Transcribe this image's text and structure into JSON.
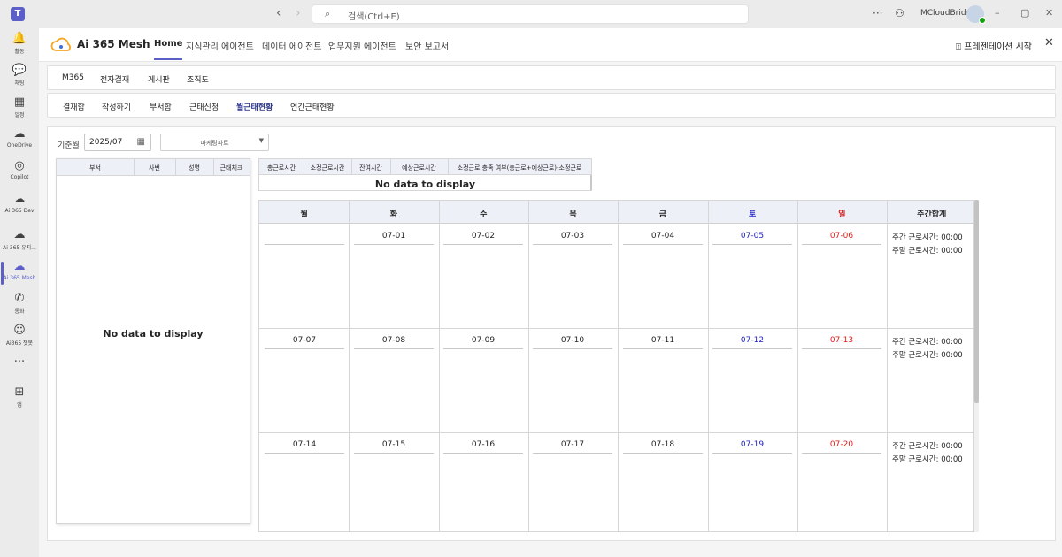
{
  "titlebar": {
    "search_placeholder": "검색(Ctrl+E)",
    "user_name": "MCloudBridge",
    "more": "···"
  },
  "rail": [
    {
      "label": "활동",
      "icon": "bell-icon",
      "glyph": "🔔"
    },
    {
      "label": "채팅",
      "icon": "chat-icon",
      "glyph": "💬"
    },
    {
      "label": "일정",
      "icon": "calendar-icon",
      "glyph": "▦"
    },
    {
      "label": "OneDrive",
      "icon": "cloud-icon",
      "glyph": "☁"
    },
    {
      "label": "Copilot",
      "icon": "copilot-icon",
      "glyph": "◎"
    },
    {
      "label": "Ai 365 Dev",
      "icon": "ai365-icon",
      "glyph": "☁"
    },
    {
      "label": "Ai 365 유지...",
      "icon": "ai365-icon",
      "glyph": "☁"
    },
    {
      "label": "Ai 365 Mesh",
      "icon": "ai365-icon",
      "glyph": "☁"
    },
    {
      "label": "통화",
      "icon": "phone-icon",
      "glyph": "✆"
    },
    {
      "label": "Ai365 챗봇",
      "icon": "bot-icon",
      "glyph": "☺"
    },
    {
      "label": "",
      "icon": "more-icon",
      "glyph": "···"
    },
    {
      "label": "앱",
      "icon": "add-app-icon",
      "glyph": "⊞"
    }
  ],
  "rail_active_index": 7,
  "app": {
    "brand": "Ai 365 Mesh",
    "tabs": [
      "Home",
      "지식관리 에이전트",
      "데이터 에이전트",
      "업무지원 에이전트",
      "보안 보고서"
    ],
    "active_tab": "Home",
    "present_label": "프레젠테이션 시작"
  },
  "subnav1": [
    "M365",
    "전자결재",
    "게시판",
    "조직도"
  ],
  "subnav2": [
    "결재함",
    "작성하기",
    "부서함",
    "근태신청",
    "월근태현황",
    "연간근태현황"
  ],
  "subnav2_active": "월근태현황",
  "filters": {
    "month_label": "기준월",
    "month_value": "2025/07",
    "dept_value": "마케팅파트"
  },
  "employee_grid": {
    "columns": [
      "부서",
      "사번",
      "성명",
      "근태체크"
    ],
    "empty_text": "No data to display"
  },
  "summary_grid": {
    "columns": [
      "총근로시간",
      "소정근로시간",
      "잔여시간",
      "예상근로시간",
      "소정근로 충족 여부(총근로+예상근로)-소정근로"
    ],
    "empty_text": "No data to display"
  },
  "calendar": {
    "headers": [
      "월",
      "화",
      "수",
      "목",
      "금",
      "토",
      "일",
      "주간합계"
    ],
    "weeks": [
      [
        "",
        "07-01",
        "07-02",
        "07-03",
        "07-04",
        "07-05",
        "07-06"
      ],
      [
        "07-07",
        "07-08",
        "07-09",
        "07-10",
        "07-11",
        "07-12",
        "07-13"
      ],
      [
        "07-14",
        "07-15",
        "07-16",
        "07-17",
        "07-18",
        "07-19",
        "07-20"
      ]
    ],
    "weekly_total": [
      "주간 근로시간: 00:00",
      "주말 근로시간: 00:00"
    ],
    "colors": {
      "saturday": "#2222c8",
      "sunday": "#e01b1b"
    }
  }
}
